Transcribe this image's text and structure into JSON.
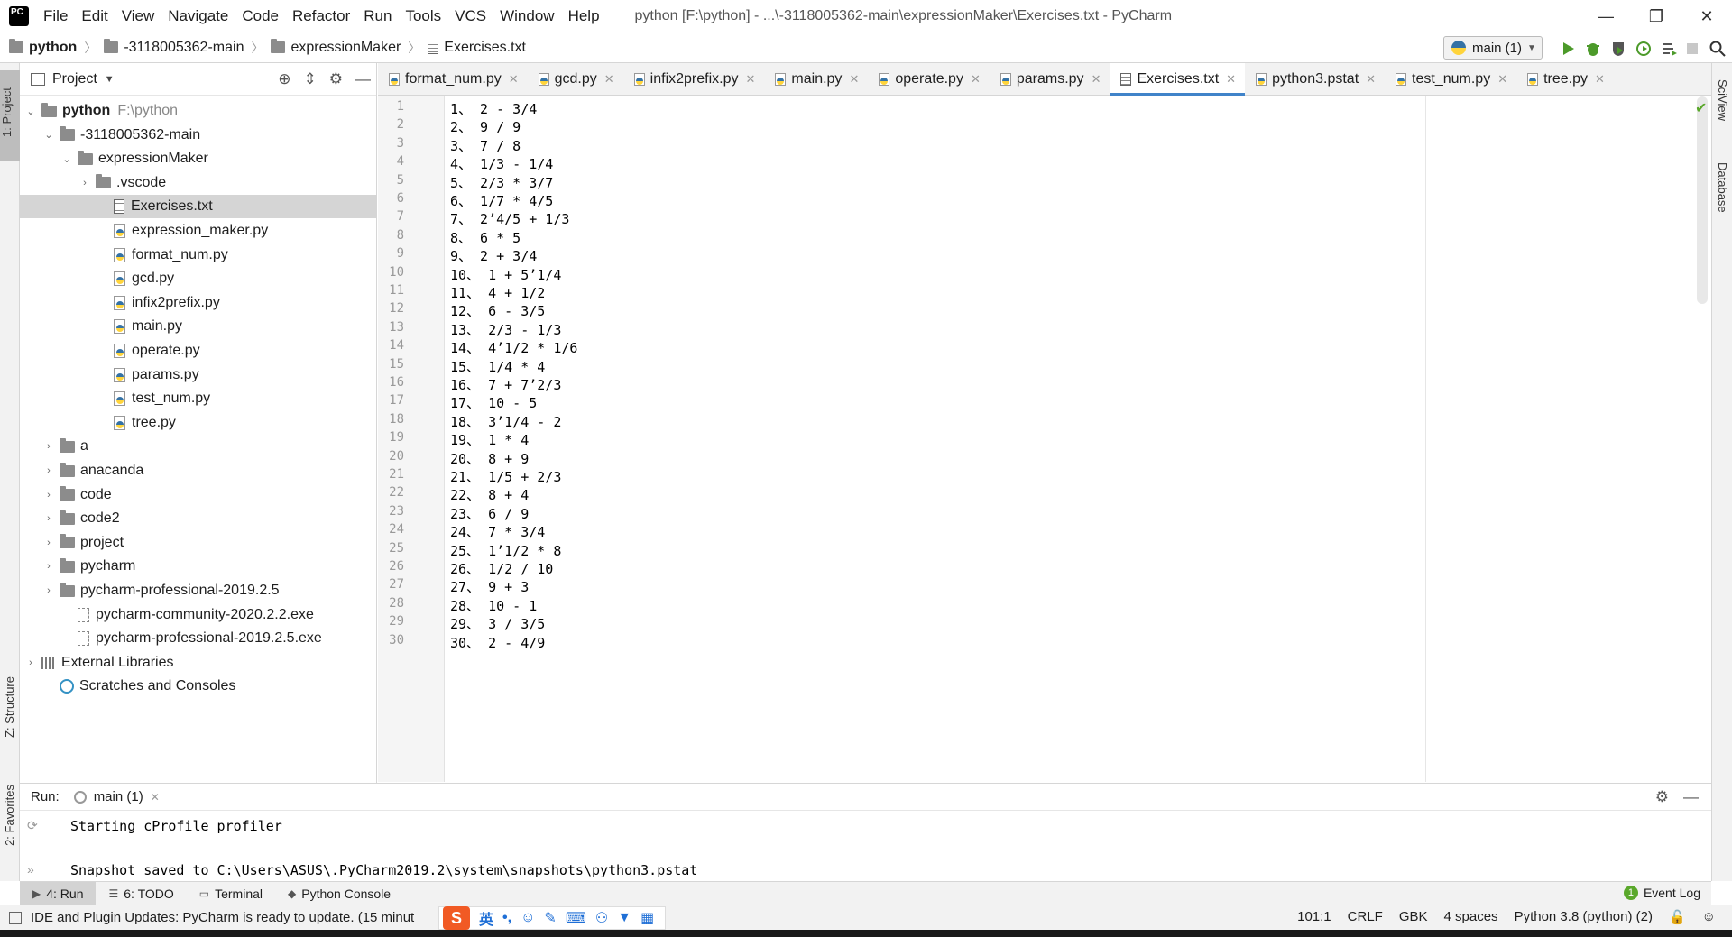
{
  "window": {
    "title": "python [F:\\python] - ...\\-3118005362-main\\expressionMaker\\Exercises.txt - PyCharm",
    "minimize": "—",
    "restore": "❐",
    "close": "✕"
  },
  "menu": [
    {
      "label": "File"
    },
    {
      "label": "Edit"
    },
    {
      "label": "View"
    },
    {
      "label": "Navigate"
    },
    {
      "label": "Code"
    },
    {
      "label": "Refactor"
    },
    {
      "label": "Run"
    },
    {
      "label": "Tools"
    },
    {
      "label": "VCS"
    },
    {
      "label": "Window"
    },
    {
      "label": "Help"
    }
  ],
  "breadcrumb": [
    "python",
    "-3118005362-main",
    "expressionMaker",
    "Exercises.txt"
  ],
  "run_config": "main (1)",
  "left_stripe": {
    "project": "1: Project",
    "structure": "Z: Structure",
    "favorites": "2: Favorites"
  },
  "right_stripe": {
    "sciview": "SciView",
    "database": "Database"
  },
  "project_panel": {
    "title": "Project",
    "tree": [
      {
        "label": "python",
        "hint": "F:\\python",
        "type": "folder",
        "indent": 0,
        "arrow": "⌄",
        "bold": true
      },
      {
        "label": "-3118005362-main",
        "type": "folder",
        "indent": 1,
        "arrow": "⌄"
      },
      {
        "label": "expressionMaker",
        "type": "folder",
        "indent": 2,
        "arrow": "⌄"
      },
      {
        "label": ".vscode",
        "type": "folder",
        "indent": 3,
        "arrow": "›"
      },
      {
        "label": "Exercises.txt",
        "type": "txt",
        "indent": 4,
        "selected": true
      },
      {
        "label": "expression_maker.py",
        "type": "py",
        "indent": 4
      },
      {
        "label": "format_num.py",
        "type": "py",
        "indent": 4
      },
      {
        "label": "gcd.py",
        "type": "py",
        "indent": 4
      },
      {
        "label": "infix2prefix.py",
        "type": "py",
        "indent": 4
      },
      {
        "label": "main.py",
        "type": "py",
        "indent": 4
      },
      {
        "label": "operate.py",
        "type": "py",
        "indent": 4
      },
      {
        "label": "params.py",
        "type": "py",
        "indent": 4
      },
      {
        "label": "test_num.py",
        "type": "py",
        "indent": 4
      },
      {
        "label": "tree.py",
        "type": "py",
        "indent": 4
      },
      {
        "label": "a",
        "type": "folder",
        "indent": 1,
        "arrow": "›"
      },
      {
        "label": "anacanda",
        "type": "folder",
        "indent": 1,
        "arrow": "›"
      },
      {
        "label": "code",
        "type": "folder",
        "indent": 1,
        "arrow": "›"
      },
      {
        "label": "code2",
        "type": "folder",
        "indent": 1,
        "arrow": "›"
      },
      {
        "label": "project",
        "type": "folder",
        "indent": 1,
        "arrow": "›"
      },
      {
        "label": "pycharm",
        "type": "folder",
        "indent": 1,
        "arrow": "›"
      },
      {
        "label": "pycharm-professional-2019.2.5",
        "type": "folder",
        "indent": 1,
        "arrow": "›"
      },
      {
        "label": "pycharm-community-2020.2.2.exe",
        "type": "exe",
        "indent": 2
      },
      {
        "label": "pycharm-professional-2019.2.5.exe",
        "type": "exe",
        "indent": 2
      },
      {
        "label": "External Libraries",
        "type": "lib",
        "indent": 0,
        "arrow": "›"
      },
      {
        "label": "Scratches and Consoles",
        "type": "scratch",
        "indent": 1
      }
    ]
  },
  "tabs": [
    {
      "label": "format_num.py",
      "kind": "py"
    },
    {
      "label": "gcd.py",
      "kind": "py"
    },
    {
      "label": "infix2prefix.py",
      "kind": "py"
    },
    {
      "label": "main.py",
      "kind": "py"
    },
    {
      "label": "operate.py",
      "kind": "py"
    },
    {
      "label": "params.py",
      "kind": "py"
    },
    {
      "label": "Exercises.txt",
      "kind": "txt",
      "active": true
    },
    {
      "label": "python3.pstat",
      "kind": "py"
    },
    {
      "label": "test_num.py",
      "kind": "py"
    },
    {
      "label": "tree.py",
      "kind": "py"
    }
  ],
  "editor_lines": [
    "1、 2 - 3/4",
    "2、 9 / 9",
    "3、 7 / 8",
    "4、 1/3 - 1/4",
    "5、 2/3 * 3/7",
    "6、 1/7 * 4/5",
    "7、 2’4/5 + 1/3",
    "8、 6 * 5",
    "9、 2 + 3/4",
    "10、 1 + 5’1/4",
    "11、 4 + 1/2",
    "12、 6 - 3/5",
    "13、 2/3 - 1/3",
    "14、 4’1/2 * 1/6",
    "15、 1/4 * 4",
    "16、 7 + 7’2/3",
    "17、 10 - 5",
    "18、 3’1/4 - 2",
    "19、 1 * 4",
    "20、 8 + 9",
    "21、 1/5 + 2/3",
    "22、 8 + 4",
    "23、 6 / 9",
    "24、 7 * 3/4",
    "25、 1’1/2 * 8",
    "26、 1/2 / 10",
    "27、 9 + 3",
    "28、 10 - 1",
    "29、 3 / 3/5",
    "30、 2 - 4/9"
  ],
  "run_panel": {
    "label": "Run:",
    "tab": "main (1)",
    "console": [
      "Starting cProfile profiler",
      "",
      "Snapshot saved to C:\\Users\\ASUS\\.PyCharm2019.2\\system\\snapshots\\python3.pstat"
    ]
  },
  "bottom_tools": [
    {
      "label": "4: Run",
      "active": true
    },
    {
      "label": "6: TODO"
    },
    {
      "label": "Terminal"
    },
    {
      "label": "Python Console"
    }
  ],
  "event_log": "Event Log",
  "event_badge": "1",
  "status": {
    "message": "IDE and Plugin Updates: PyCharm is ready to update. (15 minut",
    "position": "101:1",
    "line_sep": "CRLF",
    "encoding": "GBK",
    "indent": "4 spaces",
    "interpreter": "Python 3.8 (python) (2)"
  },
  "ime": {
    "logo": "S",
    "lang": "英"
  }
}
